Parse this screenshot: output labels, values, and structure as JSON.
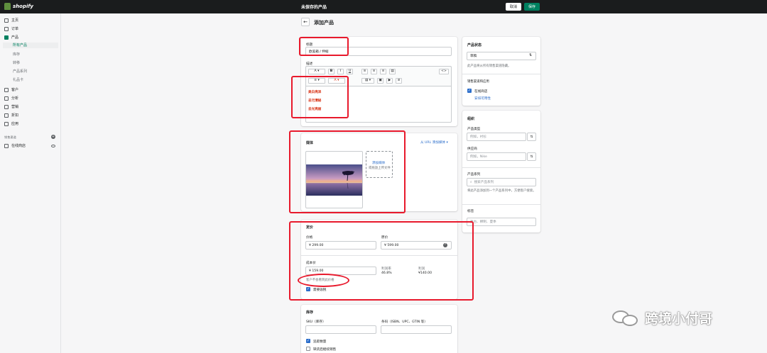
{
  "topbar": {
    "brand": "shopify",
    "title": "未保存的产品",
    "discard_label": "取消",
    "save_label": "保存"
  },
  "sidebar": {
    "items": [
      {
        "label": "主页",
        "icon": "home-icon"
      },
      {
        "label": "订单",
        "icon": "orders-icon"
      },
      {
        "label": "产品",
        "icon": "tag-icon"
      },
      {
        "label": "客户",
        "icon": "customers-icon"
      },
      {
        "label": "分析",
        "icon": "analytics-icon"
      },
      {
        "label": "营销",
        "icon": "marketing-icon"
      },
      {
        "label": "折扣",
        "icon": "discount-icon"
      },
      {
        "label": "应用",
        "icon": "apps-icon"
      }
    ],
    "product_subitems": [
      "所有产品",
      "库存",
      "转移",
      "产品系列",
      "礼品卡"
    ],
    "sales_channels_heading": "销售渠道",
    "online_store": "在线商店"
  },
  "page": {
    "title": "添加产品"
  },
  "title_card": {
    "title_label": "标题",
    "title_value": "欧美箱 / 伸缩",
    "desc_label": "描述",
    "toolbar_row1": [
      "A ▾",
      "B",
      "I",
      "U",
      "≡",
      "≡",
      "≡",
      "▤",
      "<>"
    ],
    "toolbar_row2": [
      "≡ ▾",
      "A ▾",
      "▤ ▾",
      "▣",
      "▶",
      "⊘"
    ],
    "description_lines": [
      "美白亮泽",
      "去污清秘",
      "去光亮丽"
    ]
  },
  "media_card": {
    "title": "媒体",
    "url_link": "从 URL 添加媒体 ▾",
    "add_media": "添加媒体",
    "drop_hint": "或拖放上传文件"
  },
  "pricing_card": {
    "title": "定价",
    "price_label": "价格",
    "price_value": "¥ 299.00",
    "compare_label": "原价",
    "compare_value": "¥ 599.00",
    "cost_label": "成本价",
    "cost_value": "¥ 159.00",
    "cost_hint": "客户不会看到此价格",
    "margin_label": "利润率",
    "margin_value": "46.8%",
    "profit_label": "利润",
    "profit_value": "¥140.00",
    "charge_tax_label": "需要收税"
  },
  "inventory_card": {
    "title": "库存",
    "sku_label": "SKU（库存）",
    "barcode_label": "条码（ISBN、UPC、GTIN 等）",
    "track_label": "追踪数量",
    "oos_label": "缺货后继续销售"
  },
  "status_card": {
    "title": "产品状态",
    "status_value": "草稿",
    "status_hint": "此产品将从所有销售渠道隐藏。",
    "channels_heading": "销售渠道和应用",
    "online_store": "在线商店",
    "schedule_link": "安排可用性"
  },
  "org_card": {
    "title": "组织",
    "type_label": "产品类型",
    "type_placeholder": "例如，衬衫",
    "vendor_label": "供应商",
    "vendor_placeholder": "例如，Nike",
    "collections_label": "产品系列",
    "collections_placeholder": "搜索产品系列",
    "collections_hint": "将此产品添加到一个产品系列中，方便客户搜索。",
    "tags_label": "标签",
    "tags_placeholder": "复古、棉制、夏季"
  },
  "watermark": {
    "text": "跨境小付哥",
    "icon": "wechat-icon"
  },
  "colors": {
    "accent": "#008060",
    "topbar": "#1a1c1d",
    "link": "#2c6ecb",
    "annotation_red": "#e8192c"
  }
}
